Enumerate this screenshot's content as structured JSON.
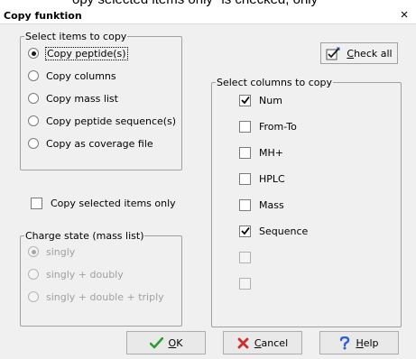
{
  "background_text": "opy selected items only\" is checked, only",
  "window": {
    "title": "Copy funktion",
    "close_label": "×"
  },
  "select_items": {
    "legend": "Select items to copy",
    "options": [
      {
        "label": "Copy peptide(s)",
        "selected": true
      },
      {
        "label": "Copy columns",
        "selected": false
      },
      {
        "label": "Copy mass list",
        "selected": false
      },
      {
        "label": "Copy peptide sequence(s)",
        "selected": false
      },
      {
        "label": "Copy as coverage file",
        "selected": false
      }
    ]
  },
  "copy_selected_only": {
    "label": "Copy selected items only",
    "checked": false
  },
  "charge_state": {
    "legend": "Charge state (mass list)",
    "options": [
      {
        "label": "singly",
        "selected": true,
        "enabled": false
      },
      {
        "label": "singly + doubly",
        "selected": false,
        "enabled": false
      },
      {
        "label": "singly + double + triply",
        "selected": false,
        "enabled": false
      }
    ]
  },
  "check_all_button": {
    "label_first": "C",
    "label_rest": "heck all",
    "icon": "check-all-icon"
  },
  "select_columns": {
    "legend": "Select columns to copy",
    "columns": [
      {
        "label": "Num",
        "checked": true,
        "enabled": true
      },
      {
        "label": "From-To",
        "checked": false,
        "enabled": true
      },
      {
        "label": "MH+",
        "checked": false,
        "enabled": true
      },
      {
        "label": "HPLC",
        "checked": false,
        "enabled": true
      },
      {
        "label": "Mass",
        "checked": false,
        "enabled": true
      },
      {
        "label": "Sequence",
        "checked": true,
        "enabled": true
      },
      {
        "label": "",
        "checked": false,
        "enabled": false
      },
      {
        "label": "",
        "checked": false,
        "enabled": false
      }
    ]
  },
  "buttons": {
    "ok": {
      "label_first": "O",
      "label_rest": "K",
      "icon": "green-check-icon",
      "icon_color": "#2e9e2e"
    },
    "cancel": {
      "label_first": "C",
      "label_rest": "ancel",
      "icon": "red-x-icon",
      "icon_color": "#d42a2a"
    },
    "help": {
      "label_first": "H",
      "label_rest": "elp",
      "icon": "question-mark-icon",
      "icon_color": "#2f5fd0"
    }
  }
}
